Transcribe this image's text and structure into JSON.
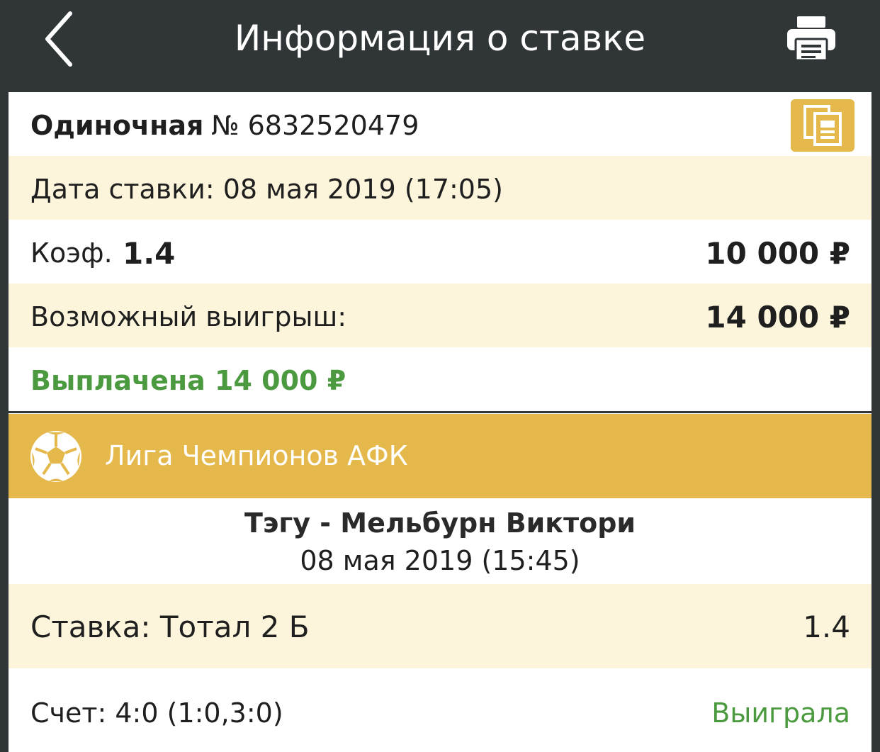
{
  "header": {
    "title": "Информация о ставке",
    "back_icon": "chevron-left-icon",
    "print_icon": "printer-icon"
  },
  "bet": {
    "type": "Одиночная",
    "number": "№ 6832520479",
    "copy_icon": "copy-document-icon",
    "date_line": "Дата ставки: 08 мая 2019 (17:05)",
    "coef_label": "Коэф.",
    "coef_value": "1.4",
    "stake": "10 000 ₽",
    "possible_win_label": "Возможный выигрыш:",
    "possible_win_value": "14 000 ₽",
    "paid_line": "Выплачена 14 000 ₽"
  },
  "event": {
    "league_icon": "soccer-ball-icon",
    "league": "Лига Чемпионов АФК",
    "teams": "Тэгу - Мельбурн Виктори",
    "datetime": "08 мая 2019 (15:45)",
    "bet_line": "Ставка: Тотал 2 Б",
    "bet_coef": "1.4",
    "score": "Счет: 4:0 (1:0,3:0)",
    "result": "Выиграла"
  },
  "colors": {
    "header_bg": "#303638",
    "accent_gold": "#e5b84b",
    "cream_row": "#fcf5dc",
    "win_green": "#4c9a3f"
  }
}
